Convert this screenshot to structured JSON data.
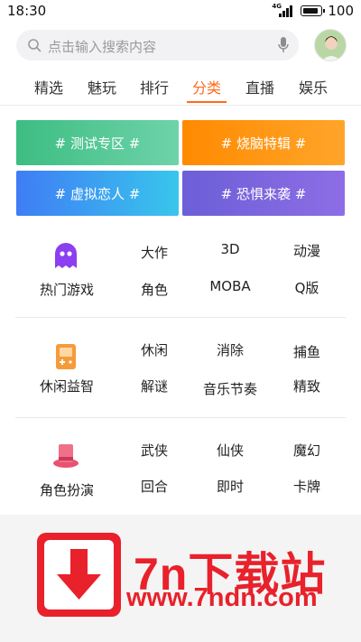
{
  "status_bar": {
    "time": "18:30",
    "network": "4G",
    "battery_level": "100"
  },
  "search": {
    "placeholder": "点击输入搜索内容"
  },
  "tabs": [
    {
      "label": "精选",
      "active": false
    },
    {
      "label": "魅玩",
      "active": false
    },
    {
      "label": "排行",
      "active": false
    },
    {
      "label": "分类",
      "active": true
    },
    {
      "label": "直播",
      "active": false
    },
    {
      "label": "娱乐",
      "active": false
    }
  ],
  "accent_color": "#ff6a1c",
  "topics": [
    {
      "label": "# 测试专区 #",
      "color": "#3dbd82"
    },
    {
      "label": "# 烧脑特辑 #",
      "color": "#ff8a00"
    },
    {
      "label": "# 虚拟恋人 #",
      "color": "#3f7df5"
    },
    {
      "label": "# 恐惧来袭 #",
      "color": "#6c5fd7"
    }
  ],
  "categories": [
    {
      "name": "热门游戏",
      "icon": "ghost-icon",
      "tags": [
        "大作",
        "3D",
        "动漫",
        "角色",
        "MOBA",
        "Q版"
      ]
    },
    {
      "name": "休闲益智",
      "icon": "gamepad-icon",
      "tags": [
        "休闲",
        "消除",
        "捕鱼",
        "解谜",
        "音乐节奏",
        "精致"
      ]
    },
    {
      "name": "角色扮演",
      "icon": "hat-icon",
      "tags": [
        "武侠",
        "仙侠",
        "魔幻",
        "回合",
        "即时",
        "卡牌"
      ]
    }
  ],
  "watermark": {
    "brand": "7n下载站",
    "url": "www.7ndn.com"
  }
}
